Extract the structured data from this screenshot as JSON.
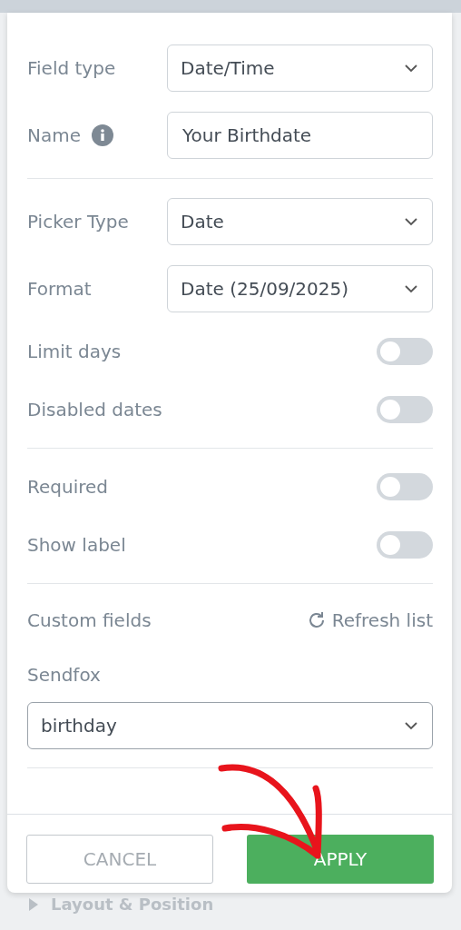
{
  "rows": [
    {
      "kind": "select",
      "label": "Field type",
      "value": "Date/Time"
    },
    {
      "kind": "text",
      "label": "Name",
      "info": true,
      "value": "Your Birthdate"
    },
    {
      "kind": "divider"
    },
    {
      "kind": "select",
      "label": "Picker Type",
      "value": "Date"
    },
    {
      "kind": "select",
      "label": "Format",
      "value": "Date (25/09/2025)"
    },
    {
      "kind": "toggle",
      "label": "Limit days",
      "on": false
    },
    {
      "kind": "toggle",
      "label": "Disabled dates",
      "on": false
    },
    {
      "kind": "divider"
    },
    {
      "kind": "toggle",
      "label": "Required",
      "on": false
    },
    {
      "kind": "toggle",
      "label": "Show label",
      "on": false
    },
    {
      "kind": "divider"
    }
  ],
  "custom_fields": {
    "label": "Custom fields",
    "refresh": "Refresh list",
    "service": "Sendfox",
    "value": "birthday"
  },
  "buttons": {
    "cancel": "CANCEL",
    "apply": "APPLY"
  },
  "background": {
    "section": "Layout & Position"
  }
}
